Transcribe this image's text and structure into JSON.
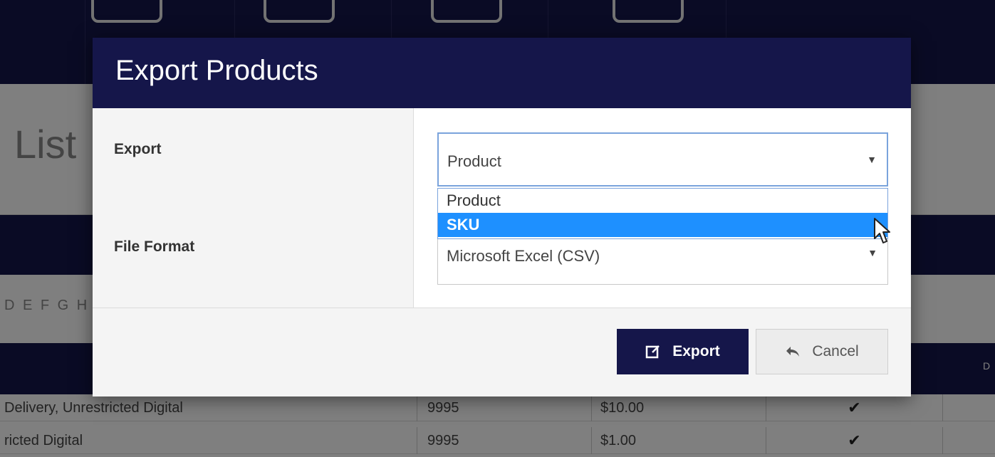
{
  "background": {
    "page_title": "List",
    "alphabet": "D E F G H",
    "table_header_right": "D",
    "rows": [
      {
        "name": "Delivery, Unrestricted Digital",
        "qty": "9995",
        "price": "$10.00",
        "check": "✔"
      },
      {
        "name": "ricted Digital",
        "qty": "9995",
        "price": "$1.00",
        "check": "✔"
      }
    ]
  },
  "modal": {
    "title": "Export Products",
    "export_label": "Export",
    "export_select": {
      "value": "Product",
      "options": [
        "Product",
        "SKU"
      ],
      "highlighted": "SKU"
    },
    "file_format_label": "File Format",
    "file_format_select": {
      "value": "Microsoft Excel (CSV)"
    },
    "buttons": {
      "export": "Export",
      "cancel": "Cancel"
    }
  },
  "colors": {
    "navy": "#15164a",
    "highlight": "#1e90ff",
    "focus_border": "#7aa3dc"
  },
  "icons": {
    "export_button_icon": "edit-square-icon",
    "cancel_button_icon": "reply-arrow-icon",
    "select_caret": "caret-down-icon",
    "cursor": "mouse-pointer-icon"
  }
}
